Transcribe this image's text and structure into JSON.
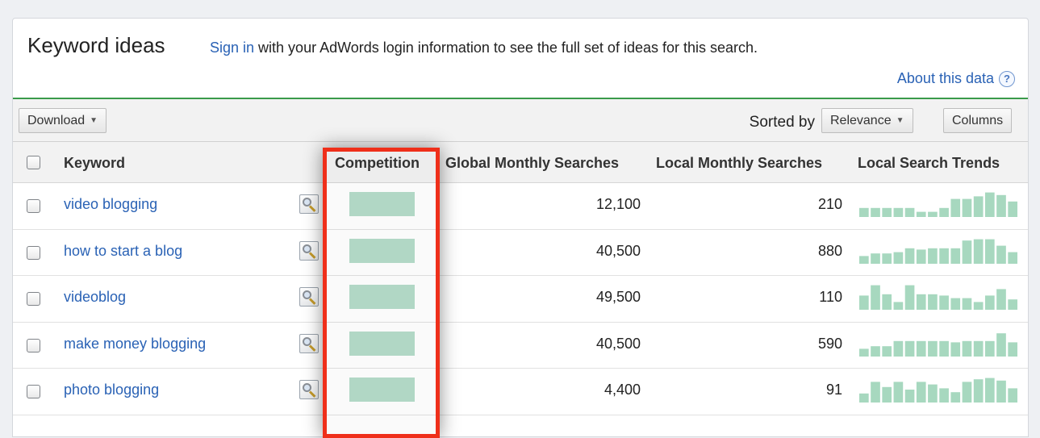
{
  "header": {
    "title": "Keyword ideas",
    "signin_link": "Sign in",
    "signin_rest": " with your AdWords login information to see the full set of ideas for this search.",
    "about_link": "About this data",
    "help_glyph": "?"
  },
  "toolbar": {
    "download_label": "Download",
    "sorted_by_label": "Sorted by",
    "sort_value": "Relevance",
    "columns_label": "Columns"
  },
  "table": {
    "columns": {
      "keyword": "Keyword",
      "competition": "Competition",
      "global": "Global Monthly Searches",
      "local": "Local Monthly Searches",
      "trends": "Local Search Trends"
    },
    "rows": [
      {
        "keyword": "video blogging",
        "global": "12,100",
        "local": "210",
        "trend": [
          0.35,
          0.35,
          0.35,
          0.35,
          0.35,
          0.2,
          0.2,
          0.35,
          0.7,
          0.7,
          0.8,
          0.95,
          0.85,
          0.6
        ],
        "competition": 1.0
      },
      {
        "keyword": "how to start a blog",
        "global": "40,500",
        "local": "880",
        "trend": [
          0.3,
          0.4,
          0.4,
          0.45,
          0.6,
          0.55,
          0.6,
          0.6,
          0.6,
          0.9,
          0.95,
          0.95,
          0.7,
          0.45
        ],
        "competition": 1.0
      },
      {
        "keyword": "videoblog",
        "global": "49,500",
        "local": "110",
        "trend": [
          0.55,
          0.95,
          0.6,
          0.3,
          0.95,
          0.6,
          0.6,
          0.55,
          0.45,
          0.45,
          0.3,
          0.55,
          0.8,
          0.4
        ],
        "competition": 1.0
      },
      {
        "keyword": "make money blogging",
        "global": "40,500",
        "local": "590",
        "trend": [
          0.3,
          0.4,
          0.4,
          0.6,
          0.6,
          0.6,
          0.6,
          0.6,
          0.55,
          0.6,
          0.6,
          0.6,
          0.9,
          0.55
        ],
        "competition": 1.0
      },
      {
        "keyword": "photo blogging",
        "global": "4,400",
        "local": "91",
        "trend": [
          0.35,
          0.8,
          0.6,
          0.8,
          0.5,
          0.8,
          0.7,
          0.55,
          0.4,
          0.8,
          0.9,
          0.95,
          0.85,
          0.55
        ],
        "competition": 1.0
      }
    ]
  },
  "colors": {
    "accent_green": "#3a9a4a",
    "competition_bar": "#b5dcc9",
    "trend_bar": "#a7d8bf",
    "link_blue": "#2a62b5",
    "highlight_red": "#ef2f1a"
  }
}
